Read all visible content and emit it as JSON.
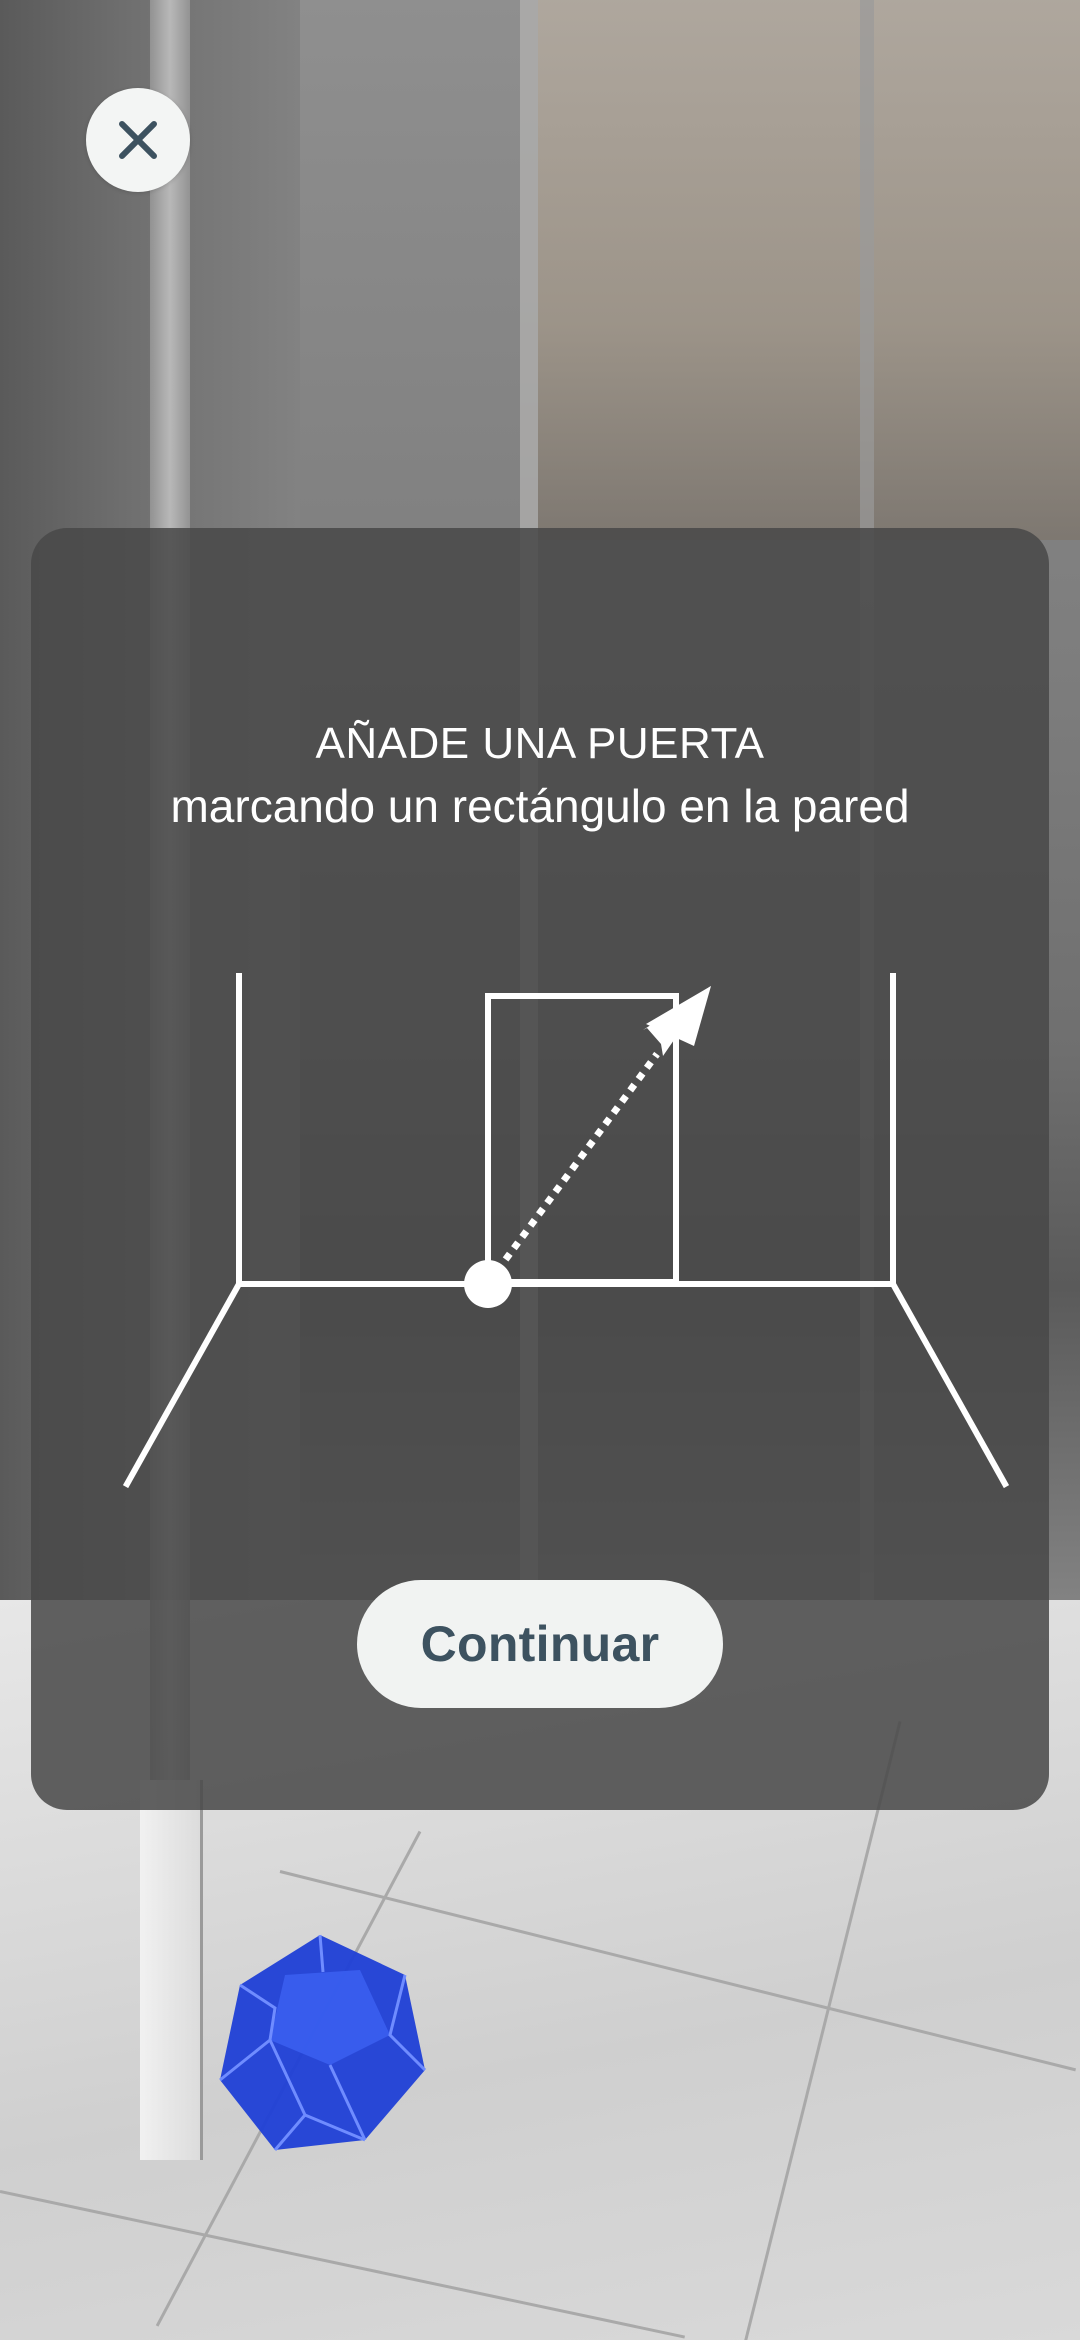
{
  "overlay": {
    "title": "AÑADE UNA PUERTA",
    "subtitle": "marcando un rectángulo en la pared",
    "continue_label": "Continuar"
  },
  "icons": {
    "close": "close-icon",
    "illustration": "door-rectangle-illustration"
  },
  "colors": {
    "button_text": "#3d5260",
    "button_bg": "#f1f3f2",
    "card_bg": "#484848"
  }
}
